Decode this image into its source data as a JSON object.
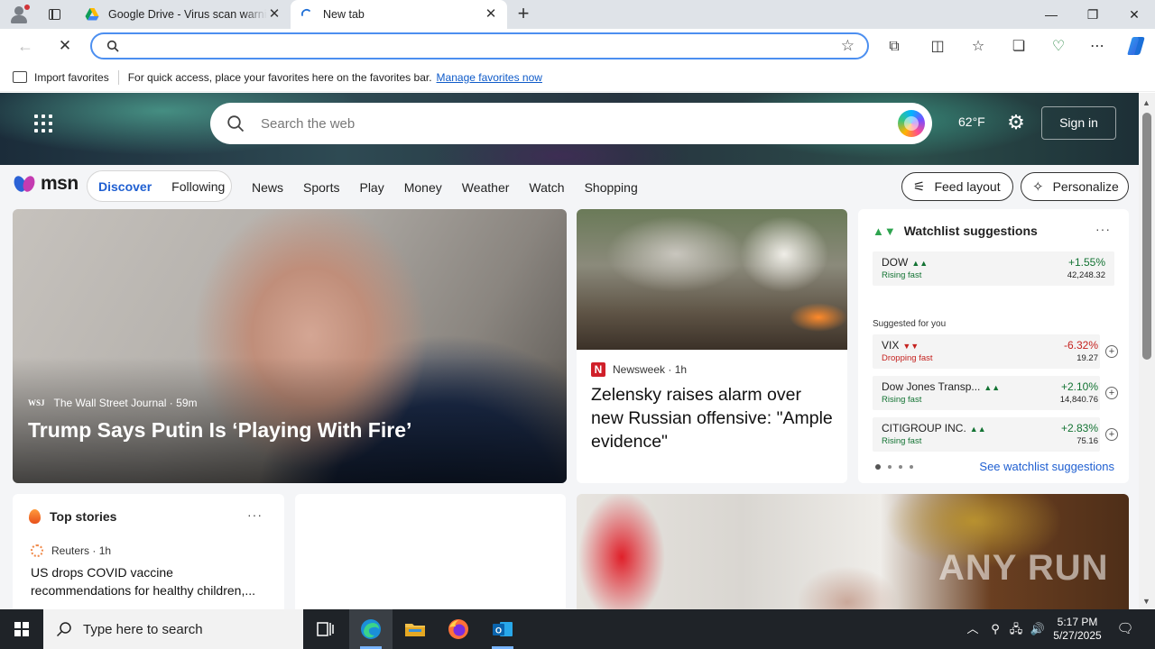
{
  "browser": {
    "tabs": [
      {
        "title": "Google Drive - Virus scan warning",
        "close": "✕"
      },
      {
        "title": "New tab",
        "close": "✕"
      }
    ],
    "new_tab": "+",
    "window_controls": {
      "minimize": "—",
      "maximize": "❐",
      "close": "✕"
    },
    "address": {
      "value": "",
      "placeholder": ""
    },
    "nav": {
      "back": "←",
      "stop": "✕"
    },
    "toolbar_icons": [
      "extensions-icon",
      "split-screen-icon",
      "favorites-icon",
      "collections-icon",
      "performance-icon",
      "more-icon",
      "copilot-icon"
    ],
    "favorites_bar": {
      "import_label": "Import favorites",
      "message": "For quick access, place your favorites here on the favorites bar.",
      "manage_link": "Manage favorites now"
    }
  },
  "msn": {
    "search_placeholder": "Search the web",
    "temperature": "62°F",
    "sign_in": "Sign in",
    "logo_text": "msn",
    "tabs": {
      "discover": "Discover",
      "following": "Following"
    },
    "categories": [
      "News",
      "Sports",
      "Play",
      "Money",
      "Weather",
      "Watch",
      "Shopping"
    ],
    "feed_layout": "Feed layout",
    "personalize": "Personalize",
    "lead_story": {
      "source_logo": "WSJ",
      "source": "The Wall Street Journal",
      "age": "59m",
      "headline": "Trump Says Putin Is ‘Playing With Fire’"
    },
    "story2": {
      "source_logo": "N",
      "source": "Newsweek",
      "age": "1h",
      "headline": "Zelensky raises alarm over new Russian offensive: \"Ample evidence\""
    },
    "watchlist": {
      "title": "Watchlist suggestions",
      "more": "···",
      "primary": {
        "name": "DOW",
        "status": "Rising fast",
        "change": "+1.55%",
        "price": "42,248.32",
        "dir": "up"
      },
      "suggested_label": "Suggested for you",
      "suggestions": [
        {
          "name": "VIX",
          "status": "Dropping fast",
          "change": "-6.32%",
          "price": "19.27",
          "dir": "down"
        },
        {
          "name": "Dow Jones Transp...",
          "status": "Rising fast",
          "change": "+2.10%",
          "price": "14,840.76",
          "dir": "up"
        },
        {
          "name": "CITIGROUP INC.",
          "status": "Rising fast",
          "change": "+2.83%",
          "price": "75.16",
          "dir": "up"
        }
      ],
      "see_all": "See watchlist suggestions"
    },
    "top_stories": {
      "title": "Top stories",
      "more": "···",
      "source": "Reuters",
      "age": "1h",
      "headline": "US drops COVID vaccine recommendations for healthy children,..."
    }
  },
  "watermark": "ANY RUN",
  "taskbar": {
    "search_placeholder": "Type here to search",
    "time": "5:17 PM",
    "date": "5/27/2025"
  },
  "colors": {
    "accent": "#1f5fd1",
    "up": "#137333",
    "down": "#c5221f",
    "taskbar": "#1f2328"
  }
}
